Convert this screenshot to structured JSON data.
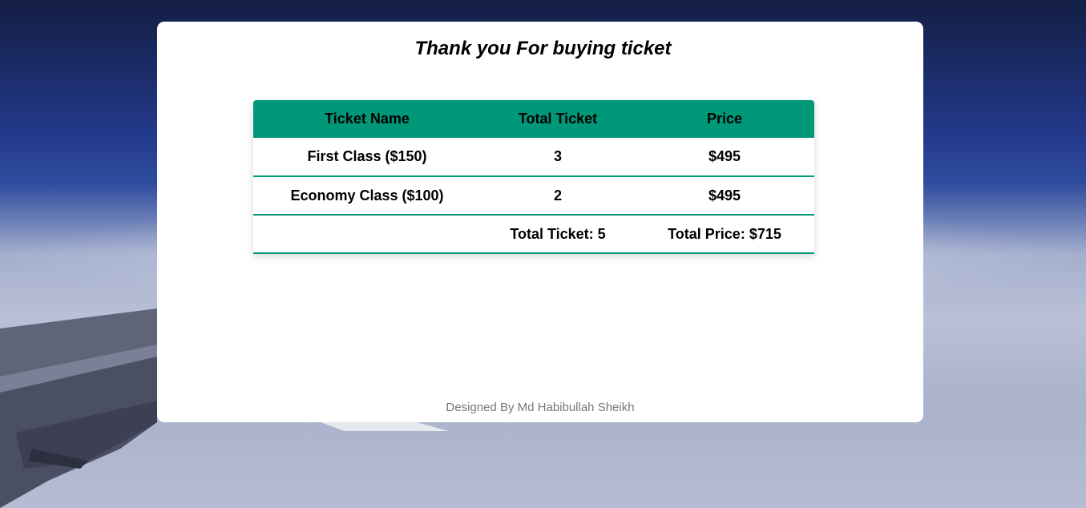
{
  "page": {
    "title": "Thank you For buying ticket",
    "footer": "Designed By Md Habibullah Sheikh"
  },
  "table": {
    "headers": [
      "Ticket Name",
      "Total Ticket",
      "Price"
    ],
    "rows": [
      {
        "name": "First Class ($150)",
        "count": "3",
        "price": "$495"
      },
      {
        "name": "Economy Class ($100)",
        "count": "2",
        "price": "$495"
      }
    ],
    "totals": {
      "name": "",
      "count": "Total Ticket: 5",
      "price": "Total Price: $715"
    }
  },
  "colors": {
    "accent": "#009879",
    "card_background": "#ffffff",
    "footer_text": "#777777"
  }
}
